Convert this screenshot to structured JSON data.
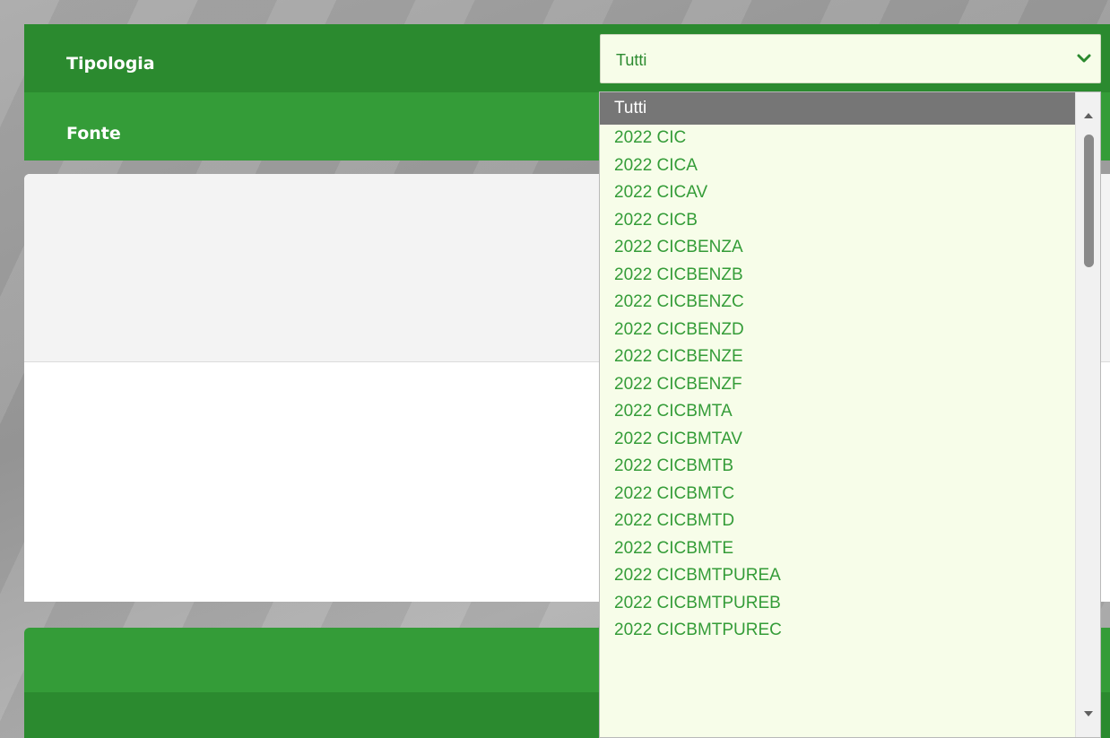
{
  "filters": {
    "tipologia_label": "Tipologia",
    "fonte_label": "Fonte",
    "tipologia_value": "Tutti"
  },
  "dropdown": {
    "options": [
      "Tutti",
      "2022 CIC",
      "2022 CICA",
      "2022 CICAV",
      "2022 CICB",
      "2022 CICBENZA",
      "2022 CICBENZB",
      "2022 CICBENZC",
      "2022 CICBENZD",
      "2022 CICBENZE",
      "2022 CICBENZF",
      "2022 CICBMTA",
      "2022 CICBMTAV",
      "2022 CICBMTB",
      "2022 CICBMTC",
      "2022 CICBMTD",
      "2022 CICBMTE",
      "2022 CICBMTPUREA",
      "2022 CICBMTPUREB",
      "2022 CICBMTPUREC"
    ],
    "selected_index": 0,
    "scroll_position": 0.05
  },
  "icons": {
    "select_chevron": "chevron-down-icon",
    "scroll_up": "triangle-up-icon",
    "scroll_down": "triangle-down-icon"
  },
  "colors": {
    "green_dark": "#2b8a2f",
    "green_light": "#349c38",
    "option_text": "#349c38",
    "select_bg": "#f7fde9",
    "selected_bg": "#767676"
  }
}
